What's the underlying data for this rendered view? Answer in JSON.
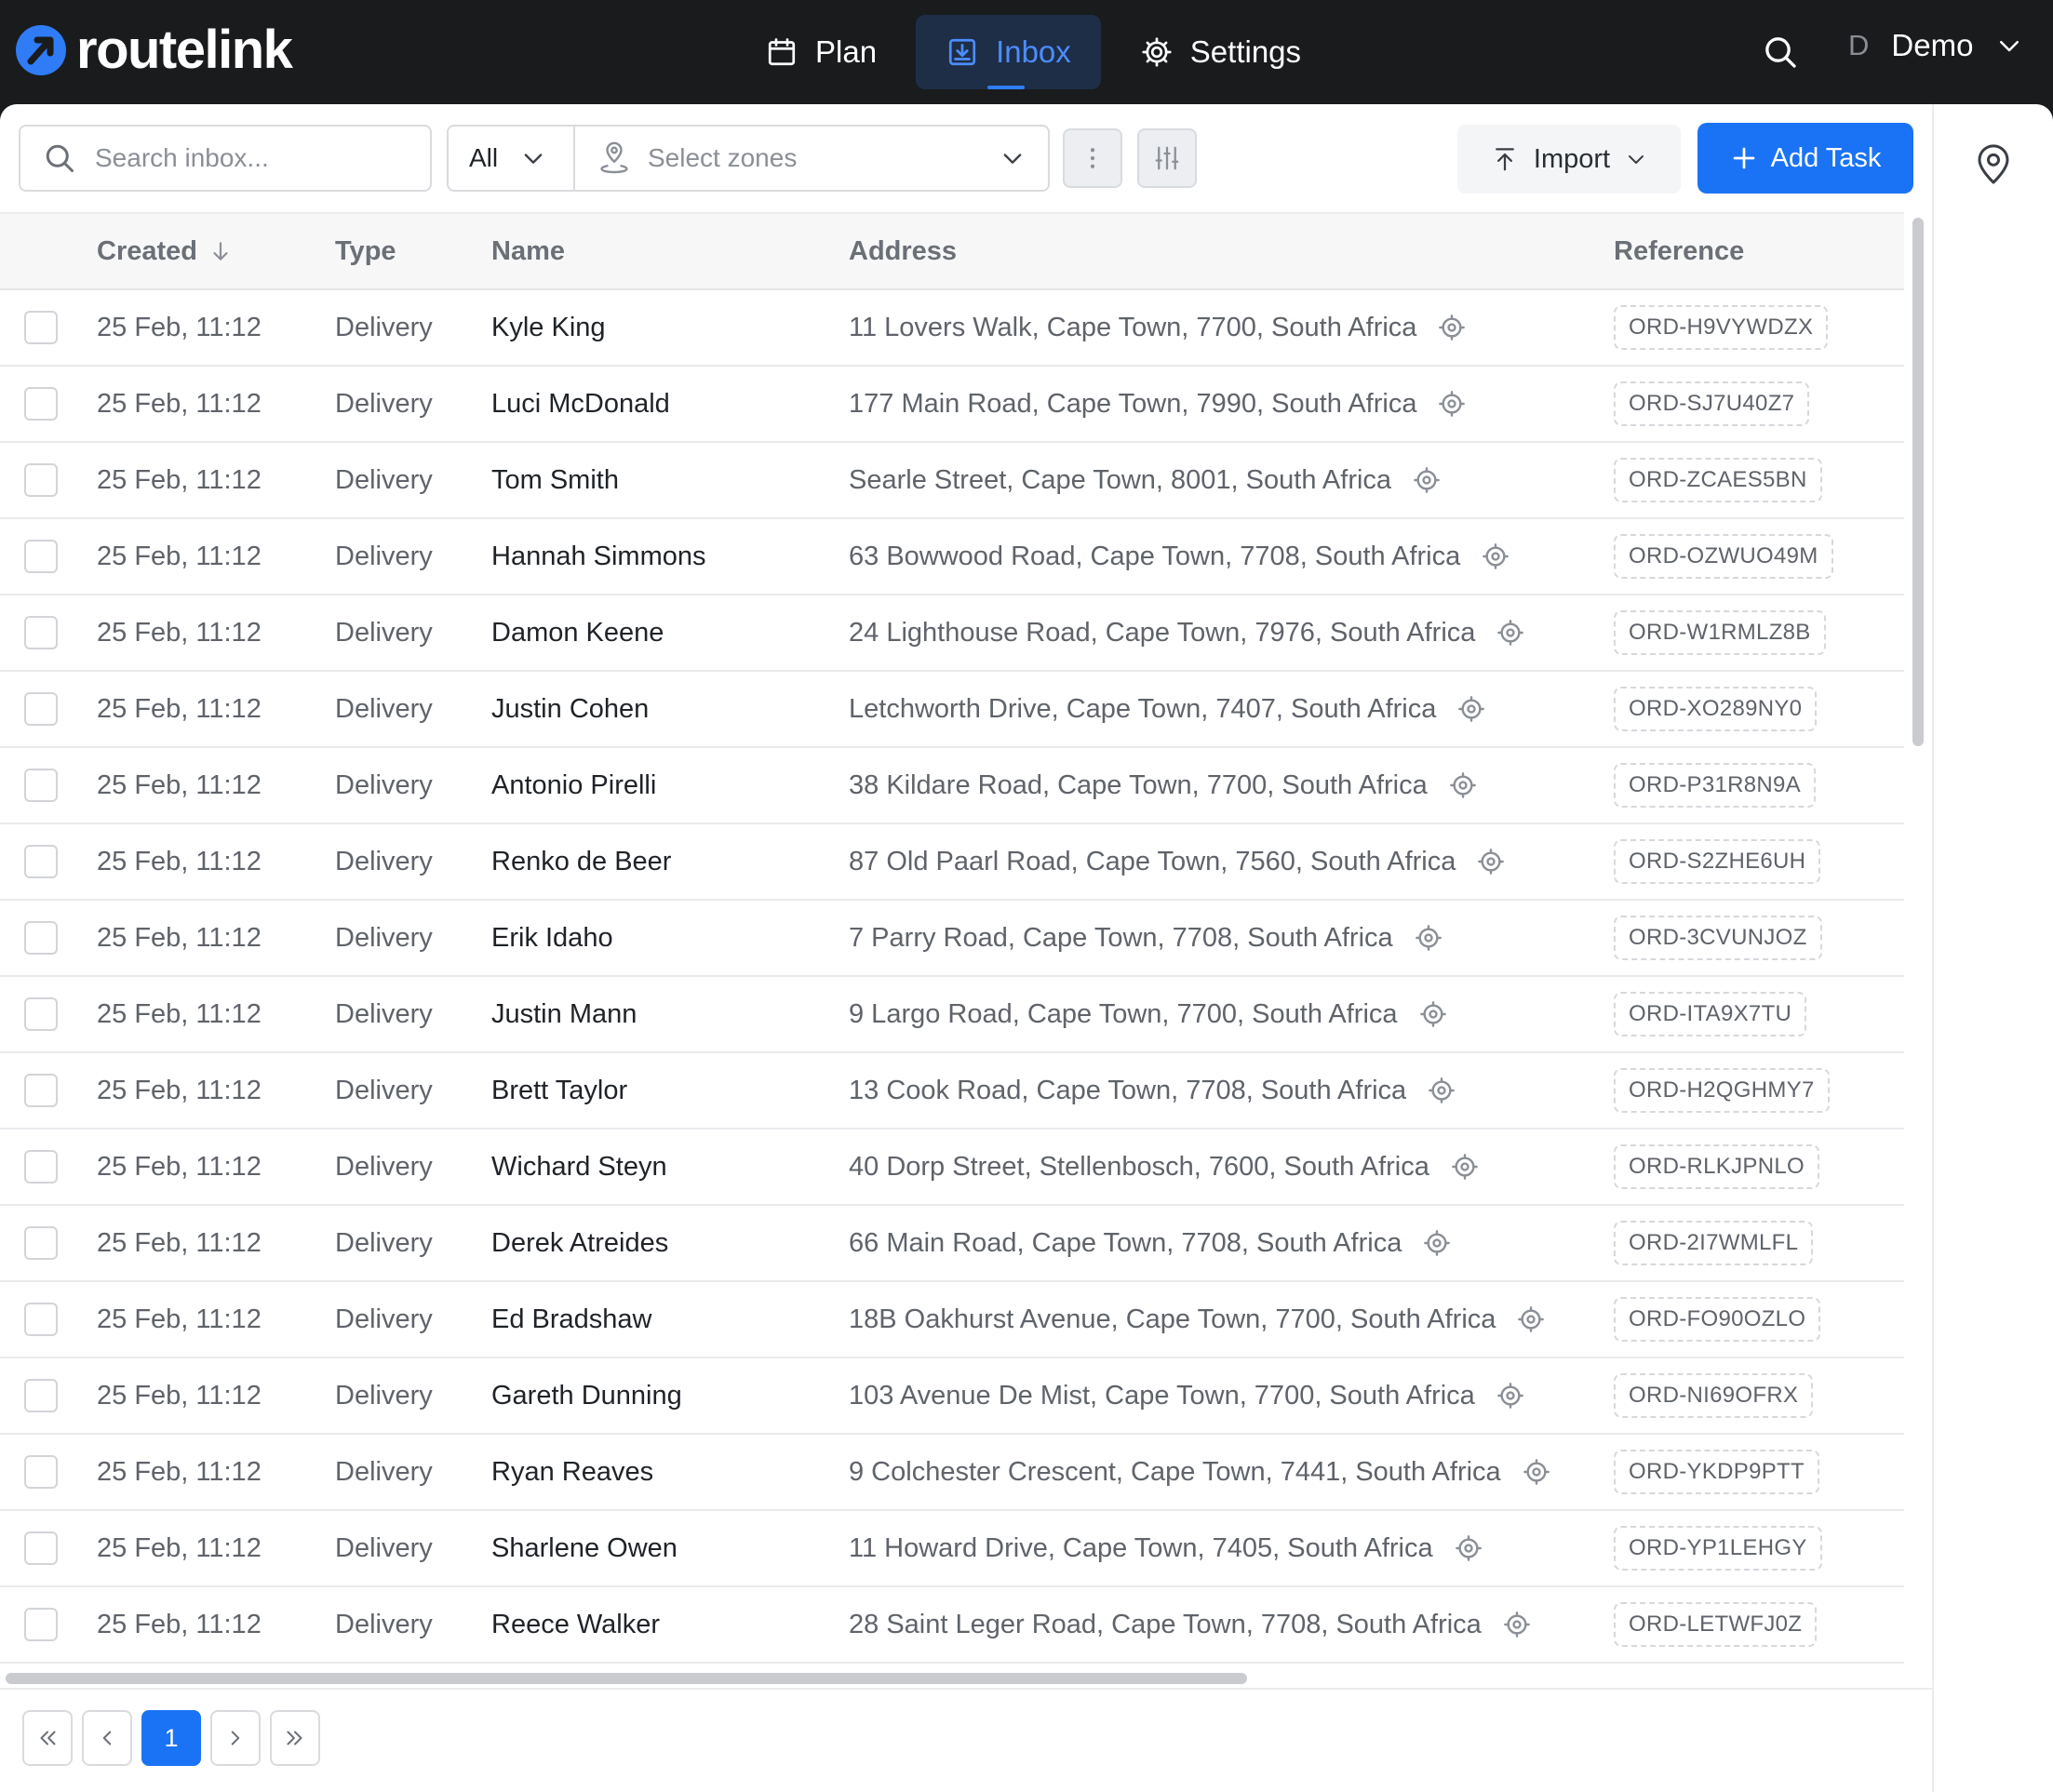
{
  "app": {
    "logo_text": "routelink",
    "nav": [
      {
        "label": "Plan",
        "icon": "calendar-icon",
        "active": false
      },
      {
        "label": "Inbox",
        "icon": "inbox-download-icon",
        "active": true
      },
      {
        "label": "Settings",
        "icon": "gear-icon",
        "active": false
      }
    ],
    "user_initial": "D",
    "user_name": "Demo"
  },
  "toolbar": {
    "search_placeholder": "Search inbox...",
    "type_filter": "All",
    "zones_placeholder": "Select zones",
    "import_label": "Import",
    "add_task_label": "Add Task"
  },
  "table": {
    "columns": {
      "created": "Created",
      "type": "Type",
      "name": "Name",
      "address": "Address",
      "reference": "Reference"
    },
    "sort": {
      "column": "created",
      "direction": "descending"
    },
    "rows": [
      {
        "created": "25 Feb, 11:12",
        "type": "Delivery",
        "name": "Kyle King",
        "address": "11 Lovers Walk, Cape Town, 7700, South Africa",
        "reference": "ORD-H9VYWDZX"
      },
      {
        "created": "25 Feb, 11:12",
        "type": "Delivery",
        "name": "Luci McDonald",
        "address": "177 Main Road, Cape Town, 7990, South Africa",
        "reference": "ORD-SJ7U40Z7"
      },
      {
        "created": "25 Feb, 11:12",
        "type": "Delivery",
        "name": "Tom Smith",
        "address": "Searle Street, Cape Town, 8001, South Africa",
        "reference": "ORD-ZCAES5BN"
      },
      {
        "created": "25 Feb, 11:12",
        "type": "Delivery",
        "name": "Hannah Simmons",
        "address": "63 Bowwood Road, Cape Town, 7708, South Africa",
        "reference": "ORD-OZWUO49M"
      },
      {
        "created": "25 Feb, 11:12",
        "type": "Delivery",
        "name": "Damon Keene",
        "address": "24 Lighthouse Road, Cape Town, 7976, South Africa",
        "reference": "ORD-W1RMLZ8B"
      },
      {
        "created": "25 Feb, 11:12",
        "type": "Delivery",
        "name": "Justin Cohen",
        "address": "Letchworth Drive, Cape Town, 7407, South Africa",
        "reference": "ORD-XO289NY0"
      },
      {
        "created": "25 Feb, 11:12",
        "type": "Delivery",
        "name": "Antonio Pirelli",
        "address": "38 Kildare Road, Cape Town, 7700, South Africa",
        "reference": "ORD-P31R8N9A"
      },
      {
        "created": "25 Feb, 11:12",
        "type": "Delivery",
        "name": "Renko de Beer",
        "address": "87 Old Paarl Road, Cape Town, 7560, South Africa",
        "reference": "ORD-S2ZHE6UH"
      },
      {
        "created": "25 Feb, 11:12",
        "type": "Delivery",
        "name": "Erik Idaho",
        "address": "7 Parry Road, Cape Town, 7708, South Africa",
        "reference": "ORD-3CVUNJOZ"
      },
      {
        "created": "25 Feb, 11:12",
        "type": "Delivery",
        "name": "Justin Mann",
        "address": "9 Largo Road, Cape Town, 7700, South Africa",
        "reference": "ORD-ITA9X7TU"
      },
      {
        "created": "25 Feb, 11:12",
        "type": "Delivery",
        "name": "Brett Taylor",
        "address": "13 Cook Road, Cape Town, 7708, South Africa",
        "reference": "ORD-H2QGHMY7"
      },
      {
        "created": "25 Feb, 11:12",
        "type": "Delivery",
        "name": "Wichard Steyn",
        "address": "40 Dorp Street, Stellenbosch, 7600, South Africa",
        "reference": "ORD-RLKJPNLO"
      },
      {
        "created": "25 Feb, 11:12",
        "type": "Delivery",
        "name": "Derek Atreides",
        "address": "66 Main Road, Cape Town, 7708, South Africa",
        "reference": "ORD-2I7WMLFL"
      },
      {
        "created": "25 Feb, 11:12",
        "type": "Delivery",
        "name": "Ed Bradshaw",
        "address": "18B Oakhurst Avenue, Cape Town, 7700, South Africa",
        "reference": "ORD-FO90OZLO"
      },
      {
        "created": "25 Feb, 11:12",
        "type": "Delivery",
        "name": "Gareth Dunning",
        "address": "103 Avenue De Mist, Cape Town, 7700, South Africa",
        "reference": "ORD-NI69OFRX"
      },
      {
        "created": "25 Feb, 11:12",
        "type": "Delivery",
        "name": "Ryan Reaves",
        "address": "9 Colchester Crescent, Cape Town, 7441, South Africa",
        "reference": "ORD-YKDP9PTT"
      },
      {
        "created": "25 Feb, 11:12",
        "type": "Delivery",
        "name": "Sharlene Owen",
        "address": "11 Howard Drive, Cape Town, 7405, South Africa",
        "reference": "ORD-YP1LEHGY"
      },
      {
        "created": "25 Feb, 11:12",
        "type": "Delivery",
        "name": "Reece Walker",
        "address": "28 Saint Leger Road, Cape Town, 7708, South Africa",
        "reference": "ORD-LETWFJ0Z"
      }
    ]
  },
  "pagination": {
    "current_page": "1"
  },
  "colors": {
    "accent": "#1a73f5",
    "topbar": "#1a1b1d",
    "active_nav_bg": "#1e2e46"
  }
}
